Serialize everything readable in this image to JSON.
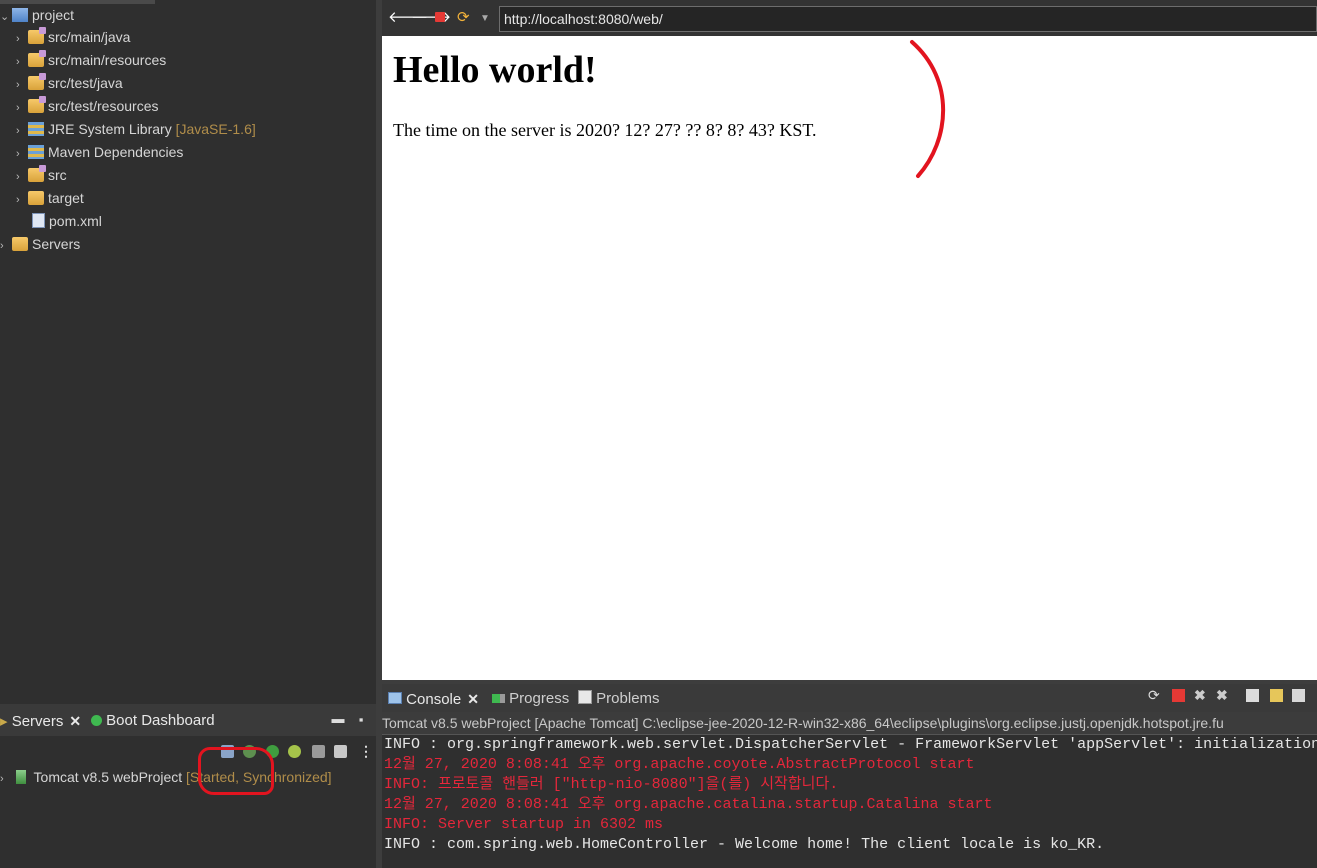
{
  "explorer": {
    "items": [
      {
        "label": "project",
        "icon": "project-icon"
      },
      {
        "label": "src/main/java",
        "icon": "package-folder-icon"
      },
      {
        "label": "src/main/resources",
        "icon": "package-folder-icon"
      },
      {
        "label": "src/test/java",
        "icon": "package-folder-icon"
      },
      {
        "label": "src/test/resources",
        "icon": "package-folder-icon"
      },
      {
        "label": "JRE System Library",
        "decor": "[JavaSE-1.6]",
        "icon": "library-icon"
      },
      {
        "label": "Maven Dependencies",
        "icon": "library-icon"
      },
      {
        "label": "src",
        "icon": "source-folder-icon"
      },
      {
        "label": "target",
        "icon": "folder-icon"
      },
      {
        "label": "pom.xml",
        "icon": "maven-file-icon"
      },
      {
        "label": "Servers",
        "icon": "folder-icon"
      }
    ]
  },
  "servers_view": {
    "tab_label": "Servers",
    "tab_close": "✕",
    "tab2_label": "Boot Dashboard",
    "server_name": "Tomcat v8.5 webProject",
    "server_state": "[Started, Synchronized]"
  },
  "browser": {
    "url": "http://localhost:8080/web/",
    "page_heading": "Hello world!",
    "page_text": "The time on the server is 2020? 12? 27? ?? 8? 8? 43? KST."
  },
  "console": {
    "tabs": [
      {
        "label": "Console",
        "close": "✕"
      },
      {
        "label": "Progress"
      },
      {
        "label": "Problems"
      }
    ],
    "title": "Tomcat v8.5 webProject [Apache Tomcat] C:\\eclipse-jee-2020-12-R-win32-x86_64\\eclipse\\plugins\\org.eclipse.justj.openjdk.hotspot.jre.fu",
    "lines": [
      {
        "text": "INFO : org.springframework.web.servlet.DispatcherServlet - FrameworkServlet 'appServlet': initialization",
        "kind": "normal"
      },
      {
        "text": "12월 27, 2020 8:08:41 오후 org.apache.coyote.AbstractProtocol start",
        "kind": "err"
      },
      {
        "text": "INFO: 프로토콜 핸들러 [\"http-nio-8080\"]을(를) 시작합니다.",
        "kind": "err"
      },
      {
        "text": "12월 27, 2020 8:08:41 오후 org.apache.catalina.startup.Catalina start",
        "kind": "err"
      },
      {
        "text": "INFO: Server startup in 6302 ms",
        "kind": "err"
      },
      {
        "text": "INFO : com.spring.web.HomeController - Welcome home! The client locale is ko_KR.",
        "kind": "normal"
      }
    ]
  },
  "colors": {
    "panel_bg": "#2f2f2f",
    "decoration": "#b08d4a",
    "console_error": "#e5273b",
    "annotation_red": "#e2141f"
  }
}
